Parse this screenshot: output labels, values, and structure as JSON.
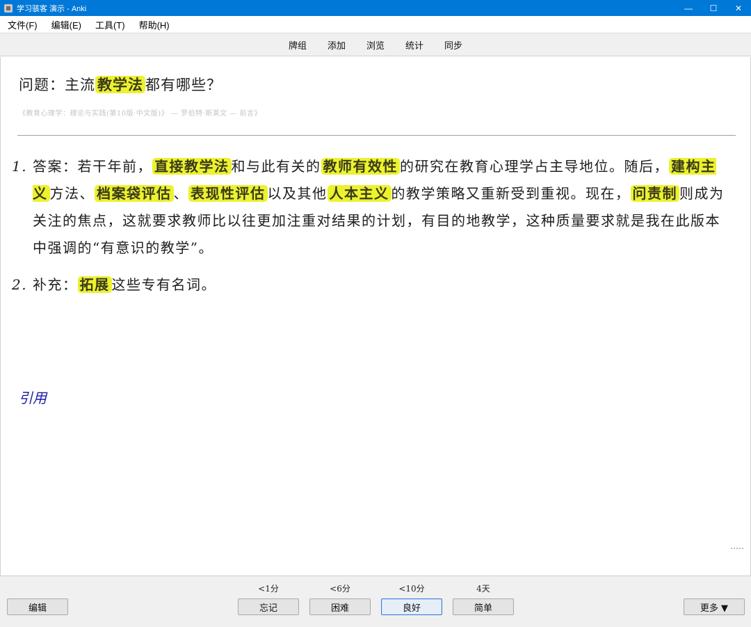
{
  "window": {
    "title": "学习骇客 演示 - Anki",
    "minimize_glyph": "—",
    "maximize_glyph": "☐",
    "close_glyph": "✕"
  },
  "menubar": {
    "items": [
      {
        "label": "文件(F)"
      },
      {
        "label": "编辑(E)"
      },
      {
        "label": "工具(T)"
      },
      {
        "label": "帮助(H)"
      }
    ]
  },
  "toolbar": {
    "items": [
      {
        "label": "牌组"
      },
      {
        "label": "添加"
      },
      {
        "label": "浏览"
      },
      {
        "label": "统计"
      },
      {
        "label": "同步"
      }
    ]
  },
  "card": {
    "question": {
      "prefix": "问题：主流",
      "highlight": "教学法",
      "suffix": "都有哪些？"
    },
    "source": "《教育心理学：理论与实践(第10版·中文版)》 — 罗伯特·斯莱文 — 前言》",
    "answers": [
      {
        "num": "1.",
        "segments": [
          {
            "t": "答案：若干年前，",
            "hl": false
          },
          {
            "t": "直接教学法",
            "hl": true
          },
          {
            "t": "和与此有关的",
            "hl": false
          },
          {
            "t": "教师有效性",
            "hl": true
          },
          {
            "t": "的研究在教育心理学占主导地位。随后，",
            "hl": false
          },
          {
            "t": "建构主义",
            "hl": true
          },
          {
            "t": "方法、",
            "hl": false
          },
          {
            "t": "档案袋评估",
            "hl": true
          },
          {
            "t": "、",
            "hl": false
          },
          {
            "t": "表现性评估",
            "hl": true
          },
          {
            "t": "以及其他",
            "hl": false
          },
          {
            "t": "人本主义",
            "hl": true
          },
          {
            "t": "的教学策略又重新受到重视。现在，",
            "hl": false
          },
          {
            "t": "问责制",
            "hl": true
          },
          {
            "t": "则成为关注的焦点，这就要求教师比以往更加注重对结果的计划，有目的地教学，这种质量要求就是我在此版本中强调的“有意识的教学”。",
            "hl": false
          }
        ]
      },
      {
        "num": "2.",
        "segments": [
          {
            "t": "补充：",
            "hl": false
          },
          {
            "t": "拓展",
            "hl": true
          },
          {
            "t": "这些专有名词。",
            "hl": false
          }
        ]
      }
    ],
    "quote_link": "引用"
  },
  "review": {
    "edit_label": "编辑",
    "more_label": "更多 ▼",
    "answer_buttons": [
      {
        "interval": "<1分",
        "label": "忘记"
      },
      {
        "interval": "<6分",
        "label": "困难"
      },
      {
        "interval": "<10分",
        "label": "良好"
      },
      {
        "interval": "4天",
        "label": "简单"
      }
    ]
  },
  "colors": {
    "titlebar": "#0078d7",
    "highlight": "#ecf22e",
    "link": "#1a1aa6"
  }
}
